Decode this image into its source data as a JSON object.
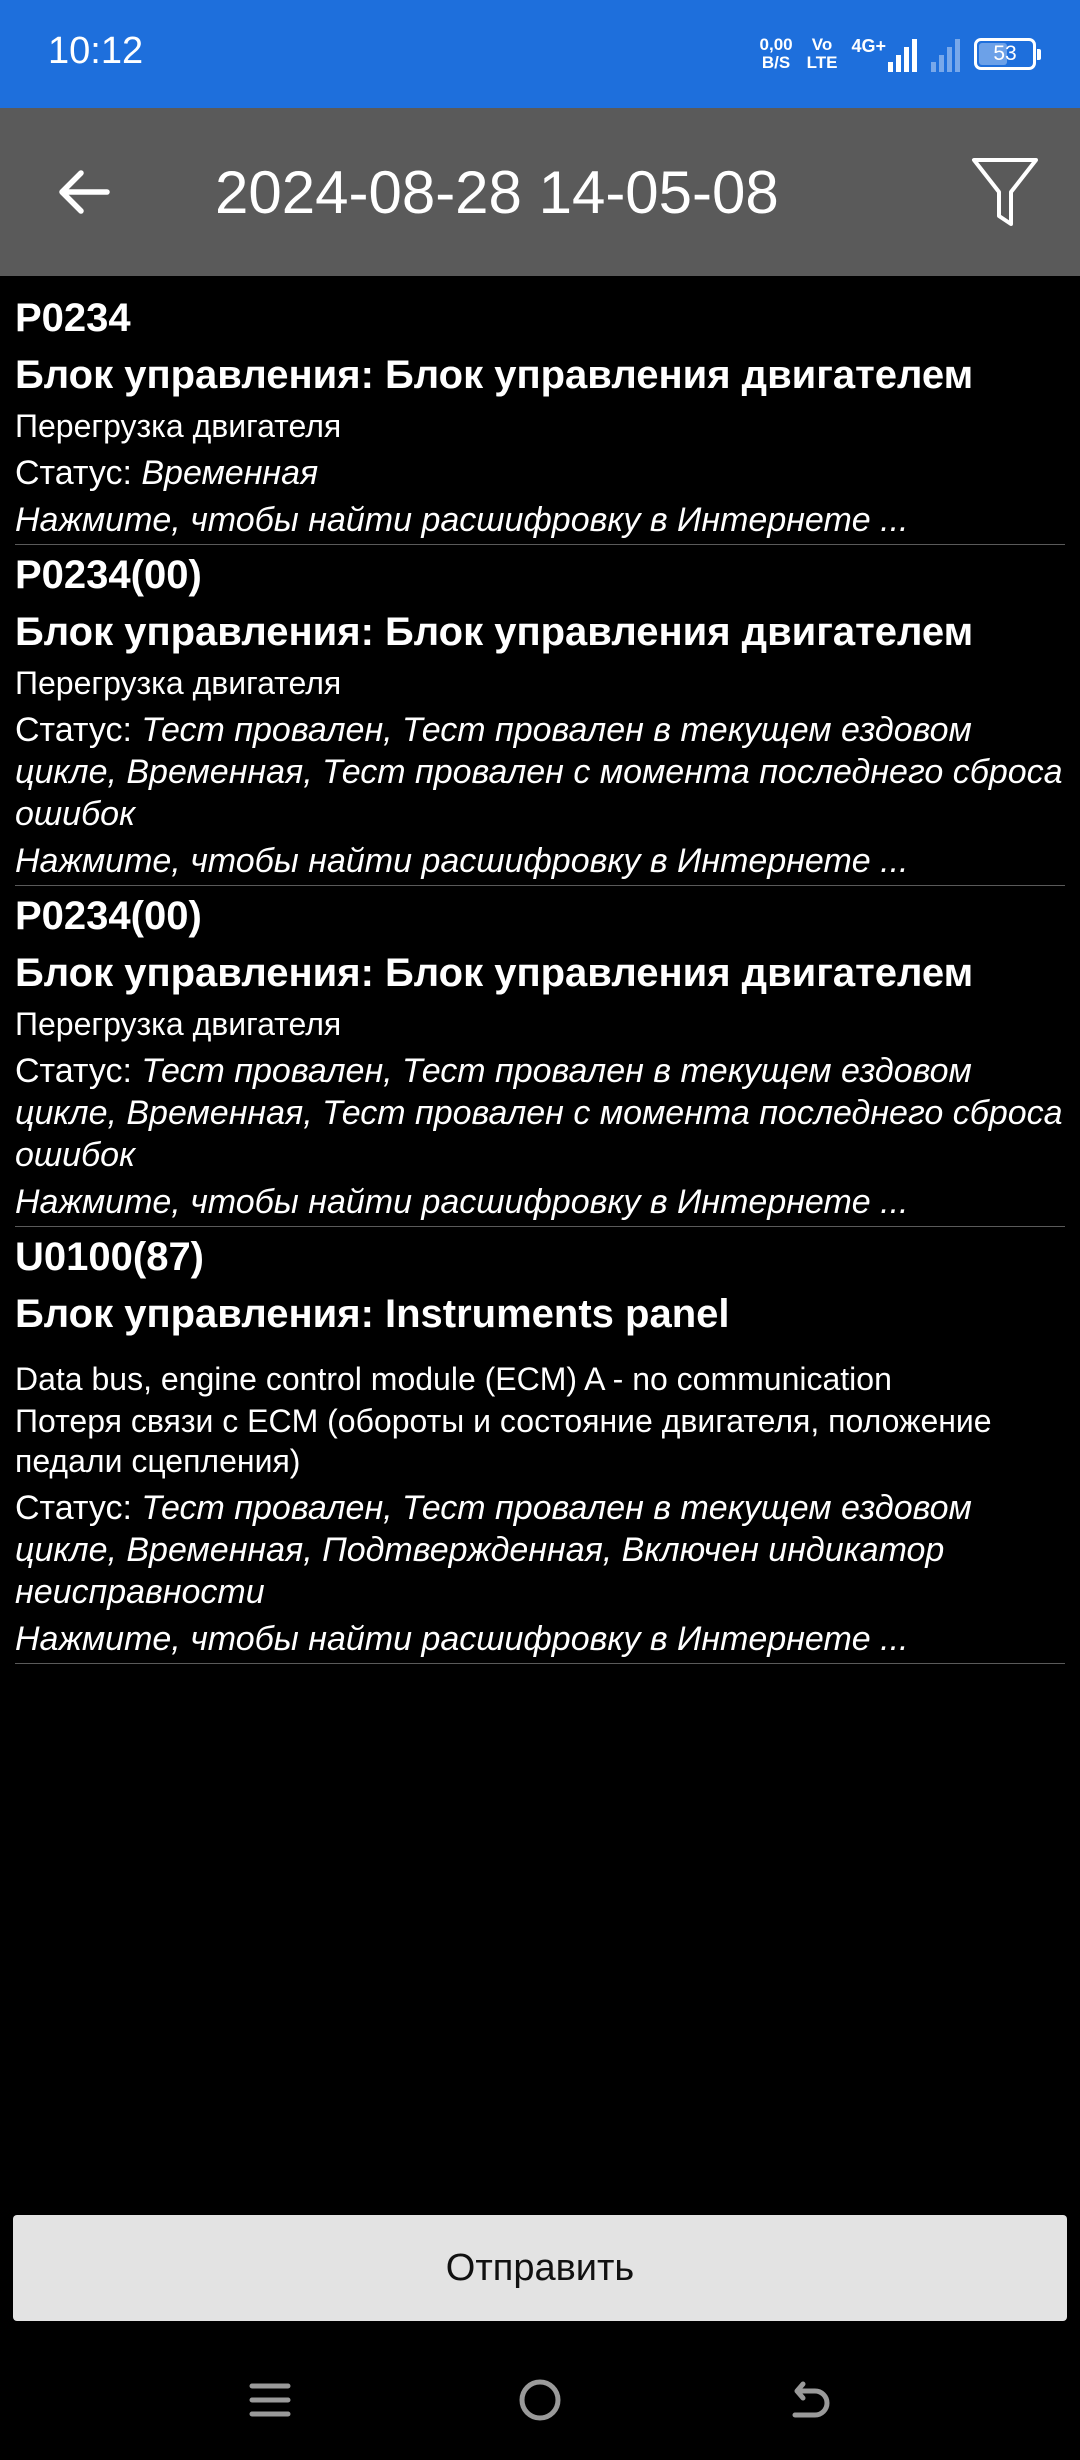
{
  "status_bar": {
    "time": "10:12",
    "net_speed_value": "0,00",
    "net_speed_unit": "B/S",
    "volte_top": "Vo",
    "volte_bottom": "LTE",
    "network_type": "4G+",
    "battery_level": "53",
    "battery_fraction": 0.53
  },
  "app_bar": {
    "title": "2024-08-28 14-05-08",
    "back_icon": "arrow-left-icon",
    "filter_icon": "funnel-icon"
  },
  "dtc_list": {
    "items": [
      {
        "code": "P0234",
        "unit": "Блок управления: Блок управления двигателем",
        "desc_lines": [
          "Перегрузка двигателя"
        ],
        "status_label": "Статус: ",
        "status_value": "Временная",
        "link": "Нажмите, чтобы найти расшифровку в Интернете ..."
      },
      {
        "code": "P0234(00)",
        "unit": "Блок управления: Блок управления двигателем",
        "desc_lines": [
          "Перегрузка двигателя"
        ],
        "status_label": "Статус: ",
        "status_value": "Тест провален, Тест провален в текущем ездовом цикле, Временная, Тест провален с момента последнего сброса ошибок",
        "link": "Нажмите, чтобы найти расшифровку в Интернете ..."
      },
      {
        "code": "P0234(00)",
        "unit": "Блок управления: Блок управления двигателем",
        "desc_lines": [
          "Перегрузка двигателя"
        ],
        "status_label": "Статус: ",
        "status_value": "Тест провален, Тест провален в текущем ездовом цикле, Временная, Тест провален с момента последнего сброса ошибок",
        "link": "Нажмите, чтобы найти расшифровку в Интернете ..."
      },
      {
        "code": "U0100(87)",
        "unit": "Блок управления: Instruments panel",
        "desc_lines": [
          "Data bus, engine control module (ECM) A - no communication",
          "Потеря связи с ECM (обороты и состояние двигателя, положение педали сцепления)"
        ],
        "status_label": "Статус: ",
        "status_value": "Тест провален, Тест провален в текущем ездовом цикле, Временная, Подтвержденная, Включен индикатор неисправности",
        "link": "Нажмите, чтобы найти расшифровку в Интернете ..."
      }
    ]
  },
  "send_button": {
    "label": "Отправить"
  },
  "nav_bar": {
    "menu_icon": "menu-icon",
    "home_icon": "home-icon",
    "back_icon": "back-icon"
  }
}
